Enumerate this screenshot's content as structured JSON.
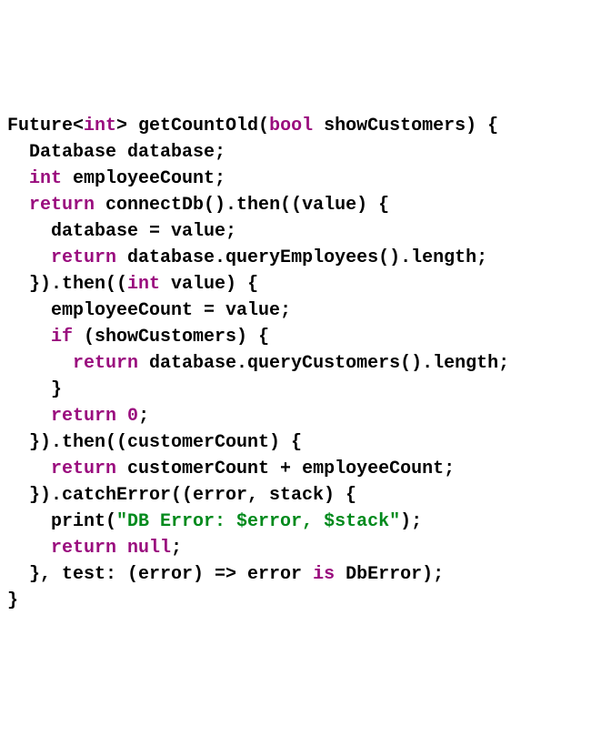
{
  "code": {
    "l1": {
      "t1": "Future<",
      "kw1": "int",
      "t2": "> getCountOld(",
      "kw2": "bool",
      "t3": " showCustomers) {"
    },
    "l2": {
      "t1": "  Database database;"
    },
    "l3": {
      "t1": "  ",
      "kw1": "int",
      "t2": " employeeCount;"
    },
    "l4": {
      "t1": "  ",
      "kw1": "return",
      "t2": " connectDb().then((value) {"
    },
    "l5": {
      "t1": "    database = value;"
    },
    "l6": {
      "t1": "    ",
      "kw1": "return",
      "t2": " database.queryEmployees().length;"
    },
    "l7": {
      "t1": "  }).then((",
      "kw1": "int",
      "t2": " value) {"
    },
    "l8": {
      "t1": "    employeeCount = value;"
    },
    "l9": {
      "t1": "    ",
      "kw1": "if",
      "t2": " (showCustomers) {"
    },
    "l10": {
      "t1": "      ",
      "kw1": "return",
      "t2": " database.queryCustomers().length;"
    },
    "l11": {
      "t1": "    }"
    },
    "l12": {
      "t1": "    ",
      "kw1": "return",
      "t2": " ",
      "kw2": "0",
      "t3": ";"
    },
    "l13": {
      "t1": "  }).then((customerCount) {"
    },
    "l14": {
      "t1": "    ",
      "kw1": "return",
      "t2": " customerCount + employeeCount;"
    },
    "l15": {
      "t1": "  }).catchError((error, stack) {"
    },
    "l16": {
      "t1": "    print(",
      "str1": "\"DB Error: $error, $stack\"",
      "t2": ");"
    },
    "l17": {
      "t1": "    ",
      "kw1": "return null",
      "t2": ";"
    },
    "l18": {
      "t1": "  }, test: (error) => error ",
      "kw1": "is",
      "t2": " DbError);"
    },
    "l19": {
      "t1": "}"
    }
  }
}
